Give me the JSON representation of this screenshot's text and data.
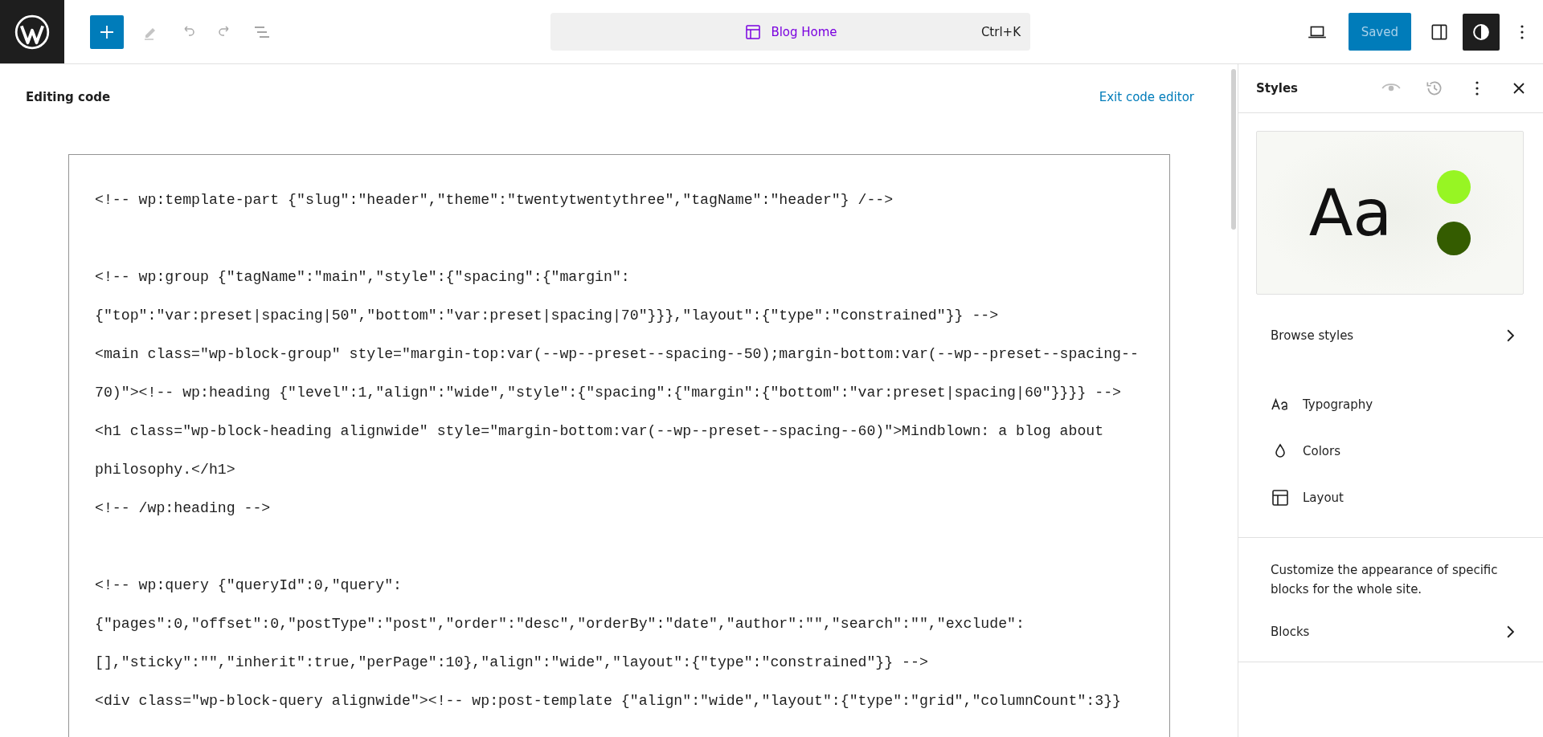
{
  "topbar": {
    "command_bar": {
      "title": "Blog Home",
      "shortcut": "Ctrl+K"
    },
    "save_button": {
      "label": "Saved",
      "disabled": true
    },
    "styles_toggle": {
      "selected": true
    }
  },
  "editor": {
    "heading": "Editing code",
    "exit_link": "Exit code editor",
    "code_blocks": [
      [
        "<!-- wp:template-part {\"slug\":\"header\",\"theme\":\"twentytwentythree\",\"tagName\":\"header\"} /-->"
      ],
      [
        "<!-- wp:group {\"tagName\":\"main\",\"style\":{\"spacing\":{\"margin\":",
        "{\"top\":\"var:preset|spacing|50\",\"bottom\":\"var:preset|spacing|70\"}}},\"layout\":{\"type\":\"constrained\"}} -->",
        "<main class=\"wp-block-group\" style=\"margin-top:var(--wp--preset--spacing--50);margin-bottom:var(--wp--preset--spacing--",
        "70)\"><!-- wp:heading {\"level\":1,\"align\":\"wide\",\"style\":{\"spacing\":{\"margin\":{\"bottom\":\"var:preset|spacing|60\"}}}} -->",
        "<h1 class=\"wp-block-heading alignwide\" style=\"margin-bottom:var(--wp--preset--spacing--60)\">Mindblown: a blog about",
        "philosophy.</h1>",
        "<!-- /wp:heading -->"
      ],
      [
        "<!-- wp:query {\"queryId\":0,\"query\":",
        "{\"pages\":0,\"offset\":0,\"postType\":\"post\",\"order\":\"desc\",\"orderBy\":\"date\",\"author\":\"\",\"search\":\"\",\"exclude\":",
        "[],\"sticky\":\"\",\"inherit\":true,\"perPage\":10},\"align\":\"wide\",\"layout\":{\"type\":\"constrained\"}} -->",
        "<div class=\"wp-block-query alignwide\"><!-- wp:post-template {\"align\":\"wide\",\"layout\":{\"type\":\"grid\",\"columnCount\":3}}"
      ]
    ]
  },
  "sidebar": {
    "title": "Styles",
    "preview": {
      "sample": "Aa",
      "swatches": [
        {
          "color": "#97f523"
        },
        {
          "color": "#345c00"
        }
      ]
    },
    "browse": "Browse styles",
    "items": [
      {
        "kind": "typography",
        "label": "Typography"
      },
      {
        "kind": "colors",
        "label": "Colors"
      },
      {
        "kind": "layout",
        "label": "Layout"
      }
    ],
    "blocks_description": "Customize the appearance of specific blocks for the whole site.",
    "blocks": "Blocks"
  }
}
